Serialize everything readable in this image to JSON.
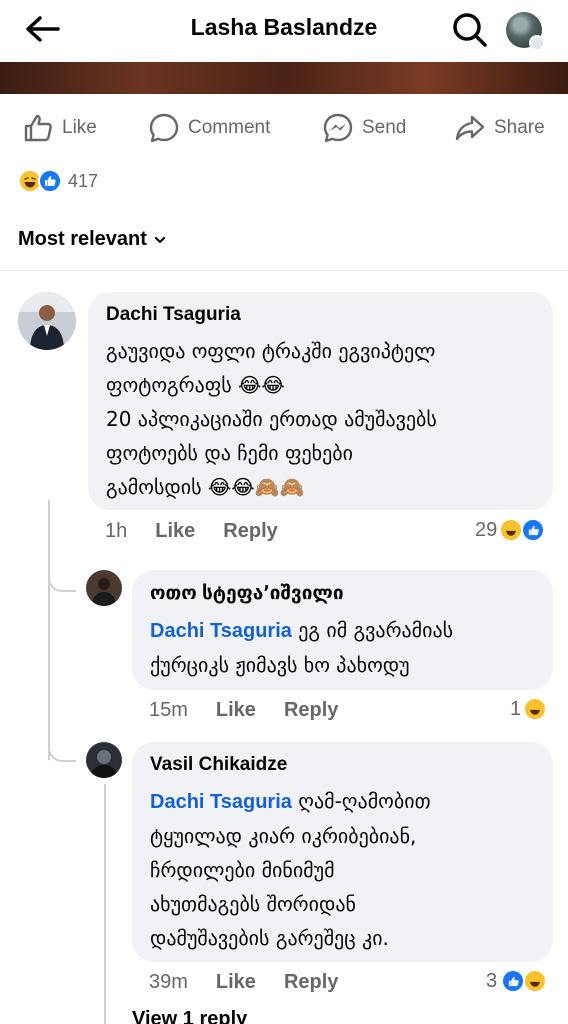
{
  "header": {
    "title": "Lasha Baslandze"
  },
  "actions": {
    "like": "Like",
    "comment": "Comment",
    "send": "Send",
    "share": "Share"
  },
  "reactions": {
    "count": "417"
  },
  "sort": {
    "label": "Most relevant"
  },
  "comments": [
    {
      "author": "Dachi Tsaguria",
      "text_line1": "გაუვიდა ოფლი ტრაკში ეგვიპტელ",
      "text_line2": "ფოტოგრაფს 😂😂",
      "text_line3": "20 აპლიკაციაში ერთად ამუშავებს",
      "text_line4": "ფოტოებს და ჩემი ფეხები",
      "text_line5": "გამოსდის 😂😂🙈🙈",
      "time": "1h",
      "like": "Like",
      "reply": "Reply",
      "reaction_count": "29"
    },
    {
      "author": "ოთო სტეფა՚იშვილი",
      "mention": "Dachi Tsaguria",
      "text_line1": " ეგ იმ გვარამიას",
      "text_line2": "ქურციკს ჟიმავს ხო პახოდუ",
      "time": "15m",
      "like": "Like",
      "reply": "Reply",
      "reaction_count": "1"
    },
    {
      "author": "Vasil Chikaidze",
      "mention": "Dachi Tsaguria",
      "text_line1": " ღამ-ღამობით",
      "text_line2": "ტყუილად კიარ იკრიბებიან,",
      "text_line3": "ჩრდილები მინიმუმ",
      "text_line4": "ახუთმაგებს შორიდან",
      "text_line5": "დამუშავების გარეშეც კი.",
      "time": "39m",
      "like": "Like",
      "reply": "Reply",
      "reaction_count": "3"
    }
  ],
  "view_replies": "View 1 reply",
  "colors": {
    "like_blue": "#1877f2",
    "mention_blue": "#1461cc",
    "bubble_bg": "#f0f2f5",
    "haha_yellow": "#f7c22e"
  }
}
